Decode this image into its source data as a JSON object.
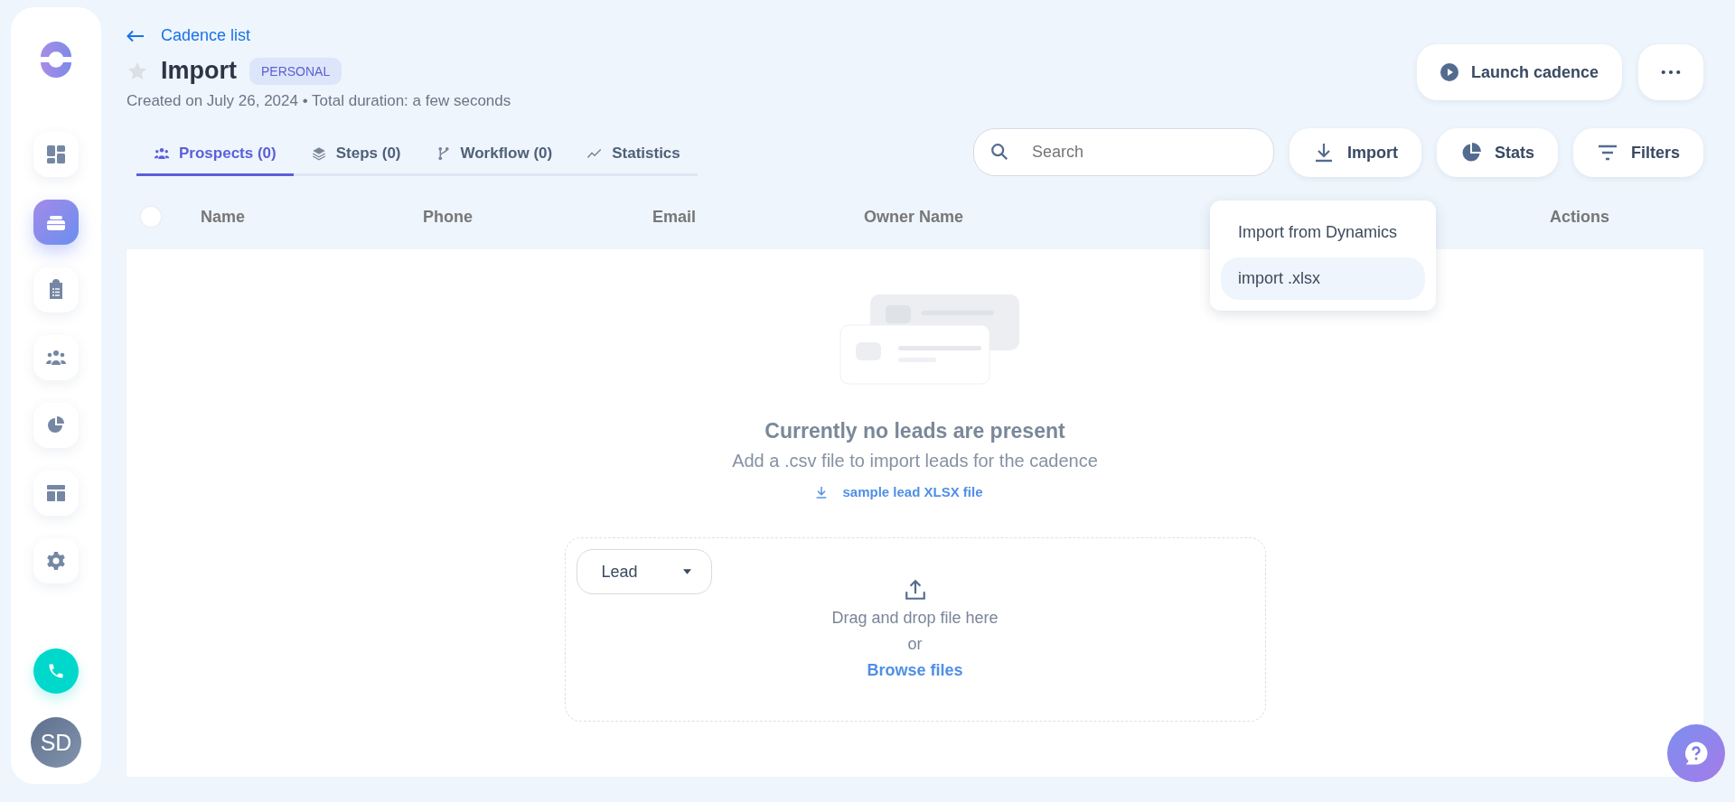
{
  "sidebar": {
    "items": [
      {
        "kind": "dashboard",
        "selected": false
      },
      {
        "kind": "cadence",
        "selected": true
      },
      {
        "kind": "tasks",
        "selected": false
      },
      {
        "kind": "people",
        "selected": false
      },
      {
        "kind": "pie",
        "selected": false
      },
      {
        "kind": "layout",
        "selected": false
      },
      {
        "kind": "settings",
        "selected": false
      }
    ],
    "avatar": "SD"
  },
  "back_link": "Cadence list",
  "title": {
    "text": "Import",
    "starred": false,
    "badge": "PERSONAL"
  },
  "subtitle": "Created on July 26, 2024 • Total duration: a few seconds",
  "header_buttons": [
    "Launch cadence"
  ],
  "tabs": [
    {
      "label": "Prospects (0)",
      "kind": "people",
      "selected": true
    },
    {
      "label": "Steps (0)",
      "kind": "layers",
      "selected": false
    },
    {
      "label": "Workflow (0)",
      "kind": "branch",
      "selected": false
    },
    {
      "label": "Statistics",
      "kind": "trend",
      "selected": false
    }
  ],
  "search": {
    "placeholder": "Search"
  },
  "toolbar": [
    {
      "label": "Import",
      "kind": "download"
    },
    {
      "label": "Stats",
      "kind": "pie"
    },
    {
      "label": "Filters",
      "kind": "filter"
    }
  ],
  "table": {
    "select_all": {
      "checked": false
    },
    "columns": [
      "Name",
      "Phone",
      "Email",
      "Owner Name",
      "Actions"
    ]
  },
  "import_menu": {
    "items": [
      {
        "label": "Import from Dynamics",
        "selected": false
      },
      {
        "label": "import .xlsx",
        "selected": true
      }
    ]
  },
  "empty_state": {
    "heading": "Currently no leads are present",
    "text": "Add a .csv file to import leads for the cadence",
    "sample_link": "sample lead XLSX file"
  },
  "dropzone": {
    "type_select": "Lead",
    "text": "Drag and drop file here",
    "or": "or",
    "browse": "Browse files"
  }
}
